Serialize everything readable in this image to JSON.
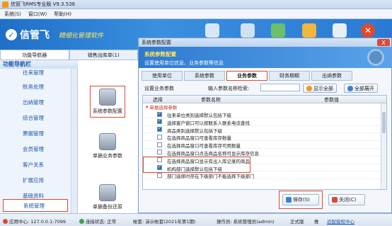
{
  "window": {
    "title": "信管飞RMS专业版 V9.3.536"
  },
  "menu": [
    "系统(S)",
    "窗口(W)",
    "帮助(H)"
  ],
  "banner": {
    "logo": "信管飞",
    "subtitle": "精细化管理软件",
    "right_text": "统"
  },
  "nav": {
    "tabs": [
      "功能导航器",
      "销售出库单(1)"
    ],
    "header": "功能导航栏",
    "items": [
      "往来管理",
      "账务处理",
      "出纳管理",
      "综合管理",
      "票据管理",
      "会员管理",
      "客户关系",
      "扩展应用",
      "基础资料",
      "系统管理"
    ]
  },
  "content": {
    "items": [
      "系统参数配置",
      "单据业务参数",
      "单据备份还原"
    ]
  },
  "dialog": {
    "title": "系统参数配置",
    "close_label": "X",
    "header_title": "系统参数配置",
    "header_subtitle": "设置使用单位信息、业务参数等信息",
    "tabs": [
      "使用单位",
      "系统参数",
      "业务参数",
      "财务期期",
      "出纳参数"
    ],
    "active_tab": "业务参数",
    "search_label": "设置业务参数",
    "search_input_label": "输入参数名称检索:",
    "search_value": "",
    "btn_show_all": "显示全部",
    "btn_expand_all": "全部展开",
    "grid_headers": [
      "选择",
      "参数名称",
      "参数值"
    ],
    "group": "单据选择参数",
    "rows": [
      {
        "checked": true,
        "text": "往来单位类别选择默认包括下级"
      },
      {
        "checked": true,
        "text": "选择客户窗口可以按联系人联系电话查找"
      },
      {
        "checked": true,
        "text": "商品类别选择默认包括下级"
      },
      {
        "checked": false,
        "text": "在选择商品窗口可查看库存数量"
      },
      {
        "checked": false,
        "text": "在选择商品窗口可查看库存可用数量"
      },
      {
        "checked": false,
        "text": "在选择商品窗口点击商品名称可显示库存信息"
      },
      {
        "checked": false,
        "text": "在选择商品窗口显示有出入库记录的商品"
      },
      {
        "checked": true,
        "text": "机构部门选择默认包括下级"
      },
      {
        "checked": false,
        "text": "部门选择时存在下级部门不能选择下级部门"
      }
    ],
    "save_label": "保存(S)",
    "close_btn_label": "关闭(C)"
  },
  "status": {
    "center": "应用中心: 127.0.0.1:7099",
    "connection": "连接状态: 正常",
    "account": "帐套: 演示帐套(2021年第1期)",
    "operator": "操作员: 系统管理员(admin)",
    "edition": "正式版",
    "extra": "推",
    "link": "适配授权中心"
  }
}
